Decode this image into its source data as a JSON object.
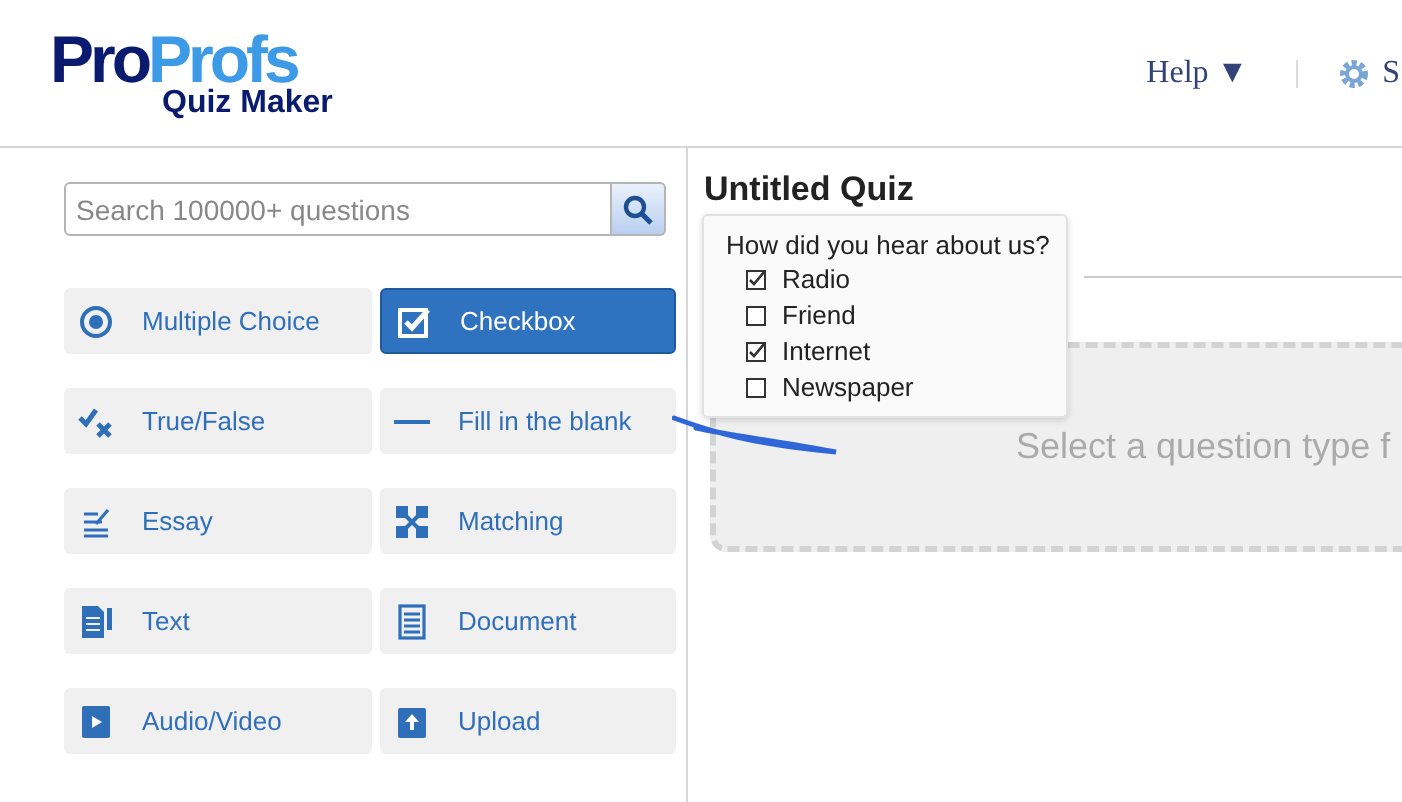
{
  "logo": {
    "part_1": "Pro",
    "part_2": "Profs",
    "subtitle": "Quiz Maker"
  },
  "header": {
    "help": "Help ▼",
    "settings": "S"
  },
  "search": {
    "placeholder": "Search 100000+ questions"
  },
  "question_types": [
    {
      "label": "Multiple Choice",
      "kind": "radio",
      "selected": false
    },
    {
      "label": "Checkbox",
      "kind": "checkbox",
      "selected": true
    },
    {
      "label": "True/False",
      "kind": "truefalse",
      "selected": false
    },
    {
      "label": "Fill in the blank",
      "kind": "blank",
      "selected": false
    },
    {
      "label": "Essay",
      "kind": "essay",
      "selected": false
    },
    {
      "label": "Matching",
      "kind": "matching",
      "selected": false
    },
    {
      "label": "Text",
      "kind": "text",
      "selected": false
    },
    {
      "label": "Document",
      "kind": "document",
      "selected": false
    },
    {
      "label": "Audio/Video",
      "kind": "media",
      "selected": false
    },
    {
      "label": "Upload",
      "kind": "upload",
      "selected": false
    }
  ],
  "quiz": {
    "title": "Untitled Quiz",
    "dropzone_text": "Select a question type f"
  },
  "preview": {
    "question": "How did you hear about us?",
    "options": [
      {
        "label": "Radio",
        "checked": true
      },
      {
        "label": "Friend",
        "checked": false
      },
      {
        "label": "Internet",
        "checked": true
      },
      {
        "label": "Newspaper",
        "checked": false
      }
    ]
  }
}
